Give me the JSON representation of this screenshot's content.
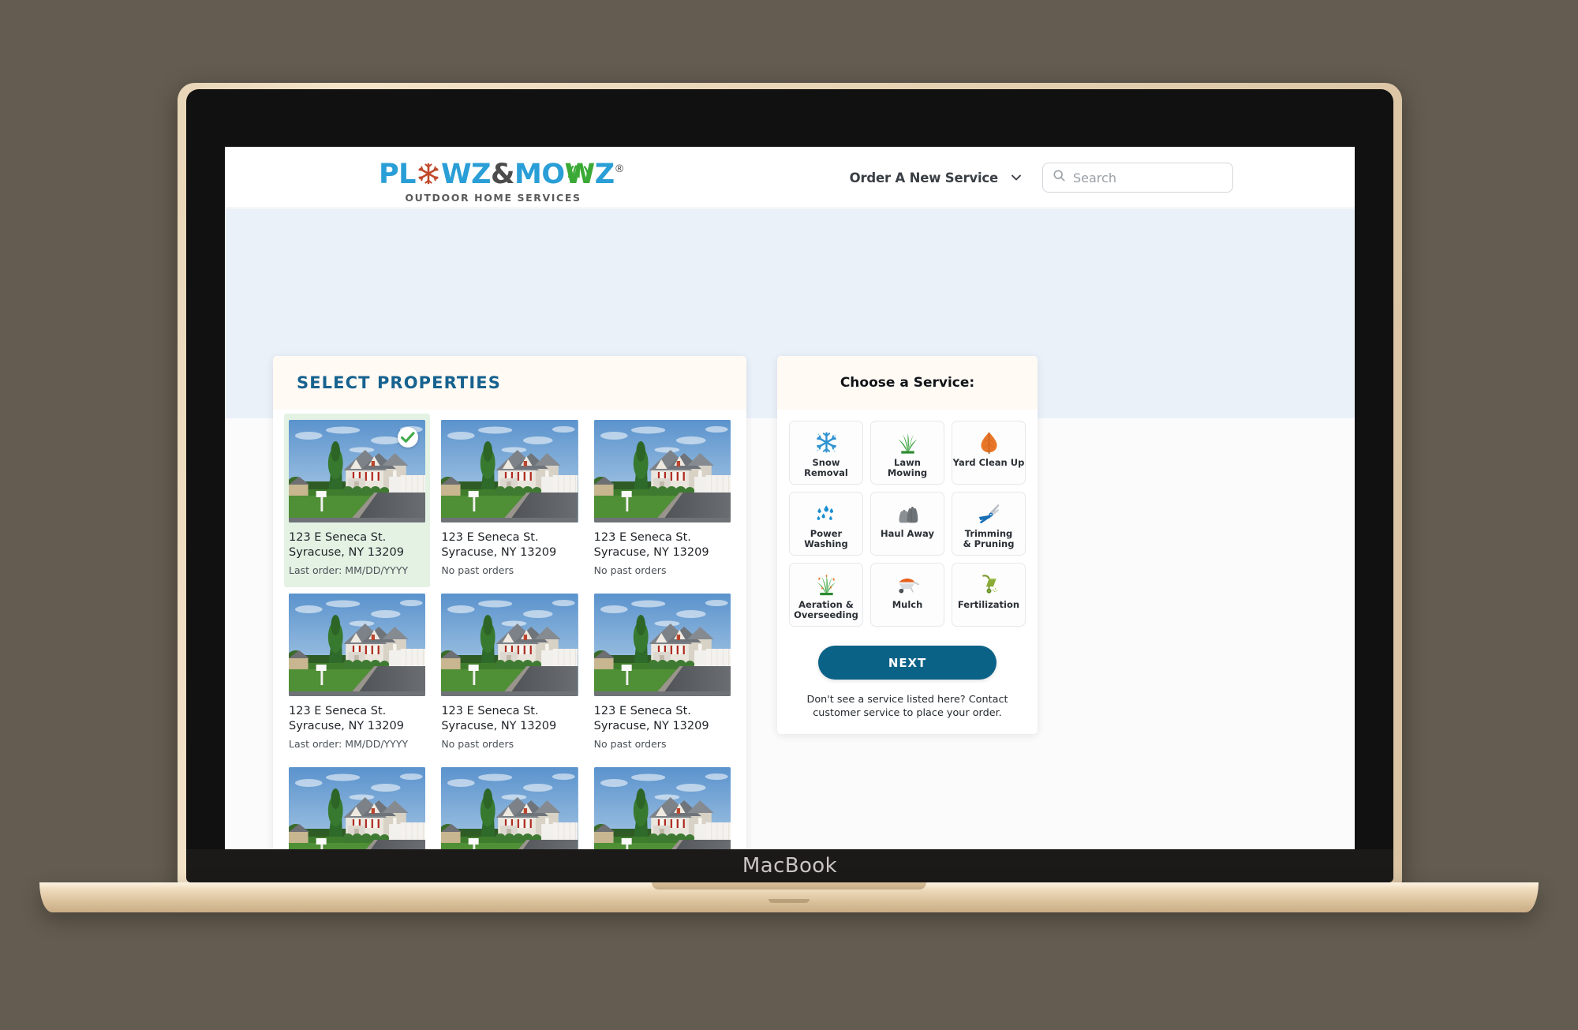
{
  "device": {
    "brand_label": "MacBook"
  },
  "header": {
    "logo": {
      "part1": "PL",
      "part1b": "WZ",
      "amp": "&",
      "part2": "MO",
      "part2b": "Z",
      "registered": "®",
      "tagline": "OUTDOOR HOME SERVICES",
      "snowflake_icon": "snowflake-icon",
      "grass_icon": "grass-icon"
    },
    "nav_link": "Order A New Service",
    "chevron_icon": "chevron-down-icon",
    "search": {
      "placeholder": "Search",
      "value": "",
      "icon": "search-icon"
    }
  },
  "properties_panel": {
    "title": "SELECT PROPERTIES",
    "cards": [
      {
        "address_line1": "123 E Seneca St.",
        "address_line2": "Syracuse, NY 13209",
        "status": "Last order: MM/DD/YYYY",
        "selected": true
      },
      {
        "address_line1": "123 E Seneca St.",
        "address_line2": "Syracuse, NY 13209",
        "status": "No past orders",
        "selected": false
      },
      {
        "address_line1": "123 E Seneca St.",
        "address_line2": "Syracuse, NY 13209",
        "status": "No past orders",
        "selected": false
      },
      {
        "address_line1": "123 E Seneca St.",
        "address_line2": "Syracuse, NY 13209",
        "status": "Last order: MM/DD/YYYY",
        "selected": false
      },
      {
        "address_line1": "123 E Seneca St.",
        "address_line2": "Syracuse, NY 13209",
        "status": "No past orders",
        "selected": false
      },
      {
        "address_line1": "123 E Seneca St.",
        "address_line2": "Syracuse, NY 13209",
        "status": "No past orders",
        "selected": false
      },
      {
        "address_line1": "",
        "address_line2": "",
        "status": "",
        "selected": false
      },
      {
        "address_line1": "",
        "address_line2": "",
        "status": "",
        "selected": false
      },
      {
        "address_line1": "",
        "address_line2": "",
        "status": "",
        "selected": false
      }
    ],
    "selected_check_icon": "check-circle-icon",
    "selected_bg_color": "#e4f2e4"
  },
  "service_panel": {
    "title": "Choose a Service:",
    "services": [
      {
        "label_line1": "Snow",
        "label_line2": "Removal",
        "icon": "snowflake-icon",
        "color": "#2f93d1"
      },
      {
        "label_line1": "Lawn",
        "label_line2": "Mowing",
        "icon": "grass-icon",
        "color": "#35a13a"
      },
      {
        "label_line1": "Yard Clean Up",
        "label_line2": "",
        "icon": "leaf-icon",
        "color": "#e8772a"
      },
      {
        "label_line1": "Power",
        "label_line2": "Washing",
        "icon": "water-drops-icon",
        "color": "#1d8fd1"
      },
      {
        "label_line1": "Haul Away",
        "label_line2": "",
        "icon": "trash-bags-icon",
        "color": "#6d7277"
      },
      {
        "label_line1": "Trimming",
        "label_line2": "& Pruning",
        "icon": "shears-icon",
        "color": "#1a6fb5"
      },
      {
        "label_line1": "Aeration &",
        "label_line2": "Overseeding",
        "icon": "aeration-grass-icon",
        "color": "#35a13a"
      },
      {
        "label_line1": "Mulch",
        "label_line2": "",
        "icon": "wheelbarrow-icon",
        "color": "#e8601c"
      },
      {
        "label_line1": "Fertilization",
        "label_line2": "",
        "icon": "spreader-icon",
        "color": "#7c9b2f"
      }
    ],
    "next_button": "NEXT",
    "footer_note": "Don't see a service listed here? Contact customer service to place your order.",
    "accent_color": "#0b6287"
  }
}
